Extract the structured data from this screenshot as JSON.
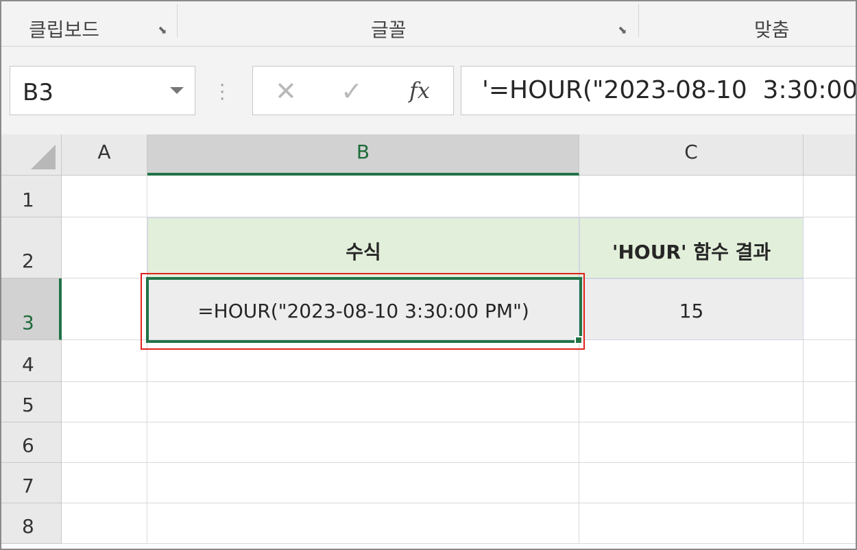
{
  "ribbon": {
    "groups": [
      {
        "label": "클립보드"
      },
      {
        "label": "글꼴"
      },
      {
        "label": "맞춤"
      }
    ]
  },
  "formula_bar": {
    "name_box": "B3",
    "cancel_glyph": "✕",
    "enter_glyph": "✓",
    "fx_label": "fx",
    "formula": "'=HOUR(\"2023-08-10  3:30:00"
  },
  "grid": {
    "columns": [
      "A",
      "B",
      "C"
    ],
    "rows": [
      "1",
      "2",
      "3",
      "4",
      "5",
      "6",
      "7",
      "8"
    ],
    "active_cell": "B3",
    "cells": {
      "B2": "수식",
      "C2": "'HOUR' 함수 결과",
      "B3": "=HOUR(\"2023-08-10  3:30:00 PM\")",
      "C3": "15"
    }
  },
  "colors": {
    "accent": "#217346",
    "header_fill": "#e2efda",
    "data_fill": "#ededed",
    "highlight": "#e0201c"
  }
}
